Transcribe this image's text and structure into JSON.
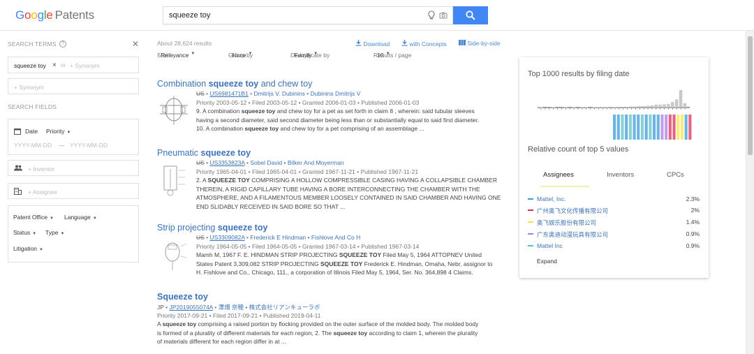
{
  "header": {
    "logo_letters": [
      "G",
      "o",
      "o",
      "g",
      "l",
      "e"
    ],
    "logo_suffix": "Patents",
    "search_value": "squeeze toy"
  },
  "left": {
    "search_terms_label": "SEARCH TERMS",
    "term_chip": "squeeze toy",
    "or_text": "or",
    "synonym_inline_placeholder": "+ Synonym",
    "synonym_placeholder": "+ Synonym",
    "search_fields_label": "SEARCH FIELDS",
    "date_label": "Date",
    "priority_label": "Priority",
    "date_from_placeholder": "YYYY-MM-DD",
    "date_dash": "—",
    "date_to_placeholder": "YYYY-MM-DD",
    "inventor_placeholder": "+ Inventor",
    "assignee_placeholder": "+ Assignee",
    "patent_office": "Patent Office",
    "language": "Language",
    "status": "Status",
    "type": "Type",
    "litigation": "Litigation"
  },
  "results_meta": {
    "count": "About 28,624 results",
    "download": "Download",
    "with_concepts": "with Concepts",
    "side_by_side": "Side-by-side",
    "sort_by": "Sort by",
    "sort_by_val": "Relevance",
    "group_by": "Group by",
    "group_by_val": "None",
    "dedupe": "Deduplicate by",
    "dedupe_val": "Family",
    "per_page": "Results / page",
    "per_page_val": "10"
  },
  "results": [
    {
      "title_pre": "Combination ",
      "title_hl": "squeeze toy",
      "title_post": " and chew toy",
      "office": "US",
      "number": "US6981471B1",
      "people": "Dmitrijs V. Dubinins • Dubinins Dmitrijs V",
      "dates": "Priority 2003-05-12 • Filed 2003-05-12 • Granted 2006-01-03 • Published 2006-01-03",
      "snippet": [
        [
          "9. A combination ",
          "squeeze toy",
          " and chew toy for a pet as set forth in claim 8 , wherein: said tubular sleeves"
        ],
        [
          "having a second diameter, said second diameter being less than or substantially equal to said first diameter.",
          "",
          ""
        ],
        [
          "10. A combination ",
          "squeeze toy",
          " and chew toy for a pet comprising of an assemblage ..."
        ]
      ]
    },
    {
      "title_pre": "Pneumatic ",
      "title_hl": "squeeze toy",
      "title_post": "",
      "office": "US",
      "number": "US3353823A",
      "people": "Sobel David • Bilker And Moyerman",
      "dates": "Priority 1965-04-01 • Filed 1965-04-01 • Granted 1967-11-21 • Published 1967-11-21",
      "snippet": [
        [
          "2. A ",
          "SQUEEZE TOY",
          " COMPRISING A HOLLOW COMPRESSIBLE CASING HAVING A COLLAPSIBLE CHAMBER"
        ],
        [
          "THEREIN, A RIGID CAPILLARY TUBE HAVING A BORE INTERCONNECTING THE CHAMBER WITH THE",
          "",
          ""
        ],
        [
          "ATMOSPHERE, AND A FILAMENTOUS MEMBER LOOSELY CONTAINED IN SAID CHAMBER AND HAVING ONE",
          "",
          ""
        ],
        [
          "END SLIDABLY RECEIVED IN SAID BORE SO THAT ...",
          "",
          ""
        ]
      ]
    },
    {
      "title_pre": "Strip projecting ",
      "title_hl": "squeeze toy",
      "title_post": "",
      "office": "US",
      "number": "US3309082A",
      "people": "Frederick E Hindman • Fishlove And Co H",
      "dates": "Priority 1964-05-05 • Filed 1964-05-05 • Granted 1967-03-14 • Published 1967-03-14",
      "snippet": [
        [
          "Mamh M, 1967 F. E. HINDMAN STRIP PROJECTING ",
          "SQUEEZE TOY",
          " Filed May 5, 1964 ATTOPNEV United"
        ],
        [
          "States Patent 3,309,082 STRIP PROJECTING ",
          "SQUEEZE TOY",
          " Frederick E. Hindman, Omaha, Nebr, assignor to"
        ],
        [
          "H. Fishlove and Co., Chicago, 111., a corporation of Illinois Filed May 5, 1964, Ser. No. 364,898 4 Claims.",
          "",
          ""
        ]
      ]
    },
    {
      "title_pre": "",
      "title_hl": "Squeeze toy",
      "title_post": "",
      "office": "JP",
      "number": "JP2019055074A",
      "people": "澤畑 奈穂 • 株式会社リアンキューラボ",
      "dates": "Priority 2017-09-21 • Filed 2017-09-21 • Published 2019-04-11",
      "snippet": [
        [
          "A ",
          "squeeze toy",
          " comprising a raised portion by flocking provided on the outer surface of the molded body. The molded body"
        ],
        [
          "is formed of a plurality of different materials for each region, 2. The ",
          "squeeze toy",
          " according to claim 1, wherein the plurality"
        ],
        [
          "of materials different for each region differ in at ...",
          "",
          ""
        ]
      ]
    }
  ],
  "card": {
    "title": "Top 1000 results by filing date",
    "subtitle": "Relative count of top 5 values",
    "tabs": [
      "Assignees",
      "Inventors",
      "CPCs"
    ],
    "values": [
      {
        "name": "Mattel, Inc.",
        "pct": "2.3%",
        "color": "#3b9bd9"
      },
      {
        "name": "广州奥飞文化传播有限公司",
        "pct": "2%",
        "color": "#d9305a"
      },
      {
        "name": "奥飞娱乐股份有限公司",
        "pct": "1.4%",
        "color": "#f4e54a"
      },
      {
        "name": "广东奥迪动漫玩具有限公司",
        "pct": "0.9%",
        "color": "#a97be0"
      },
      {
        "name": "Mattel Inc",
        "pct": "0.9%",
        "color": "#5cc2c7"
      }
    ],
    "expand": "Expand"
  },
  "chart_data": {
    "type": "bar",
    "title": "Top 1000 results by filing date",
    "values": [
      1,
      0,
      0,
      1,
      0,
      0,
      1,
      0,
      1,
      0,
      1,
      1,
      0,
      1,
      1,
      1,
      1,
      2,
      1,
      2,
      2,
      2,
      3,
      3,
      4,
      4,
      5,
      6,
      8,
      8,
      9,
      10,
      15,
      22,
      48,
      12
    ],
    "ylim": [
      0,
      50
    ]
  }
}
